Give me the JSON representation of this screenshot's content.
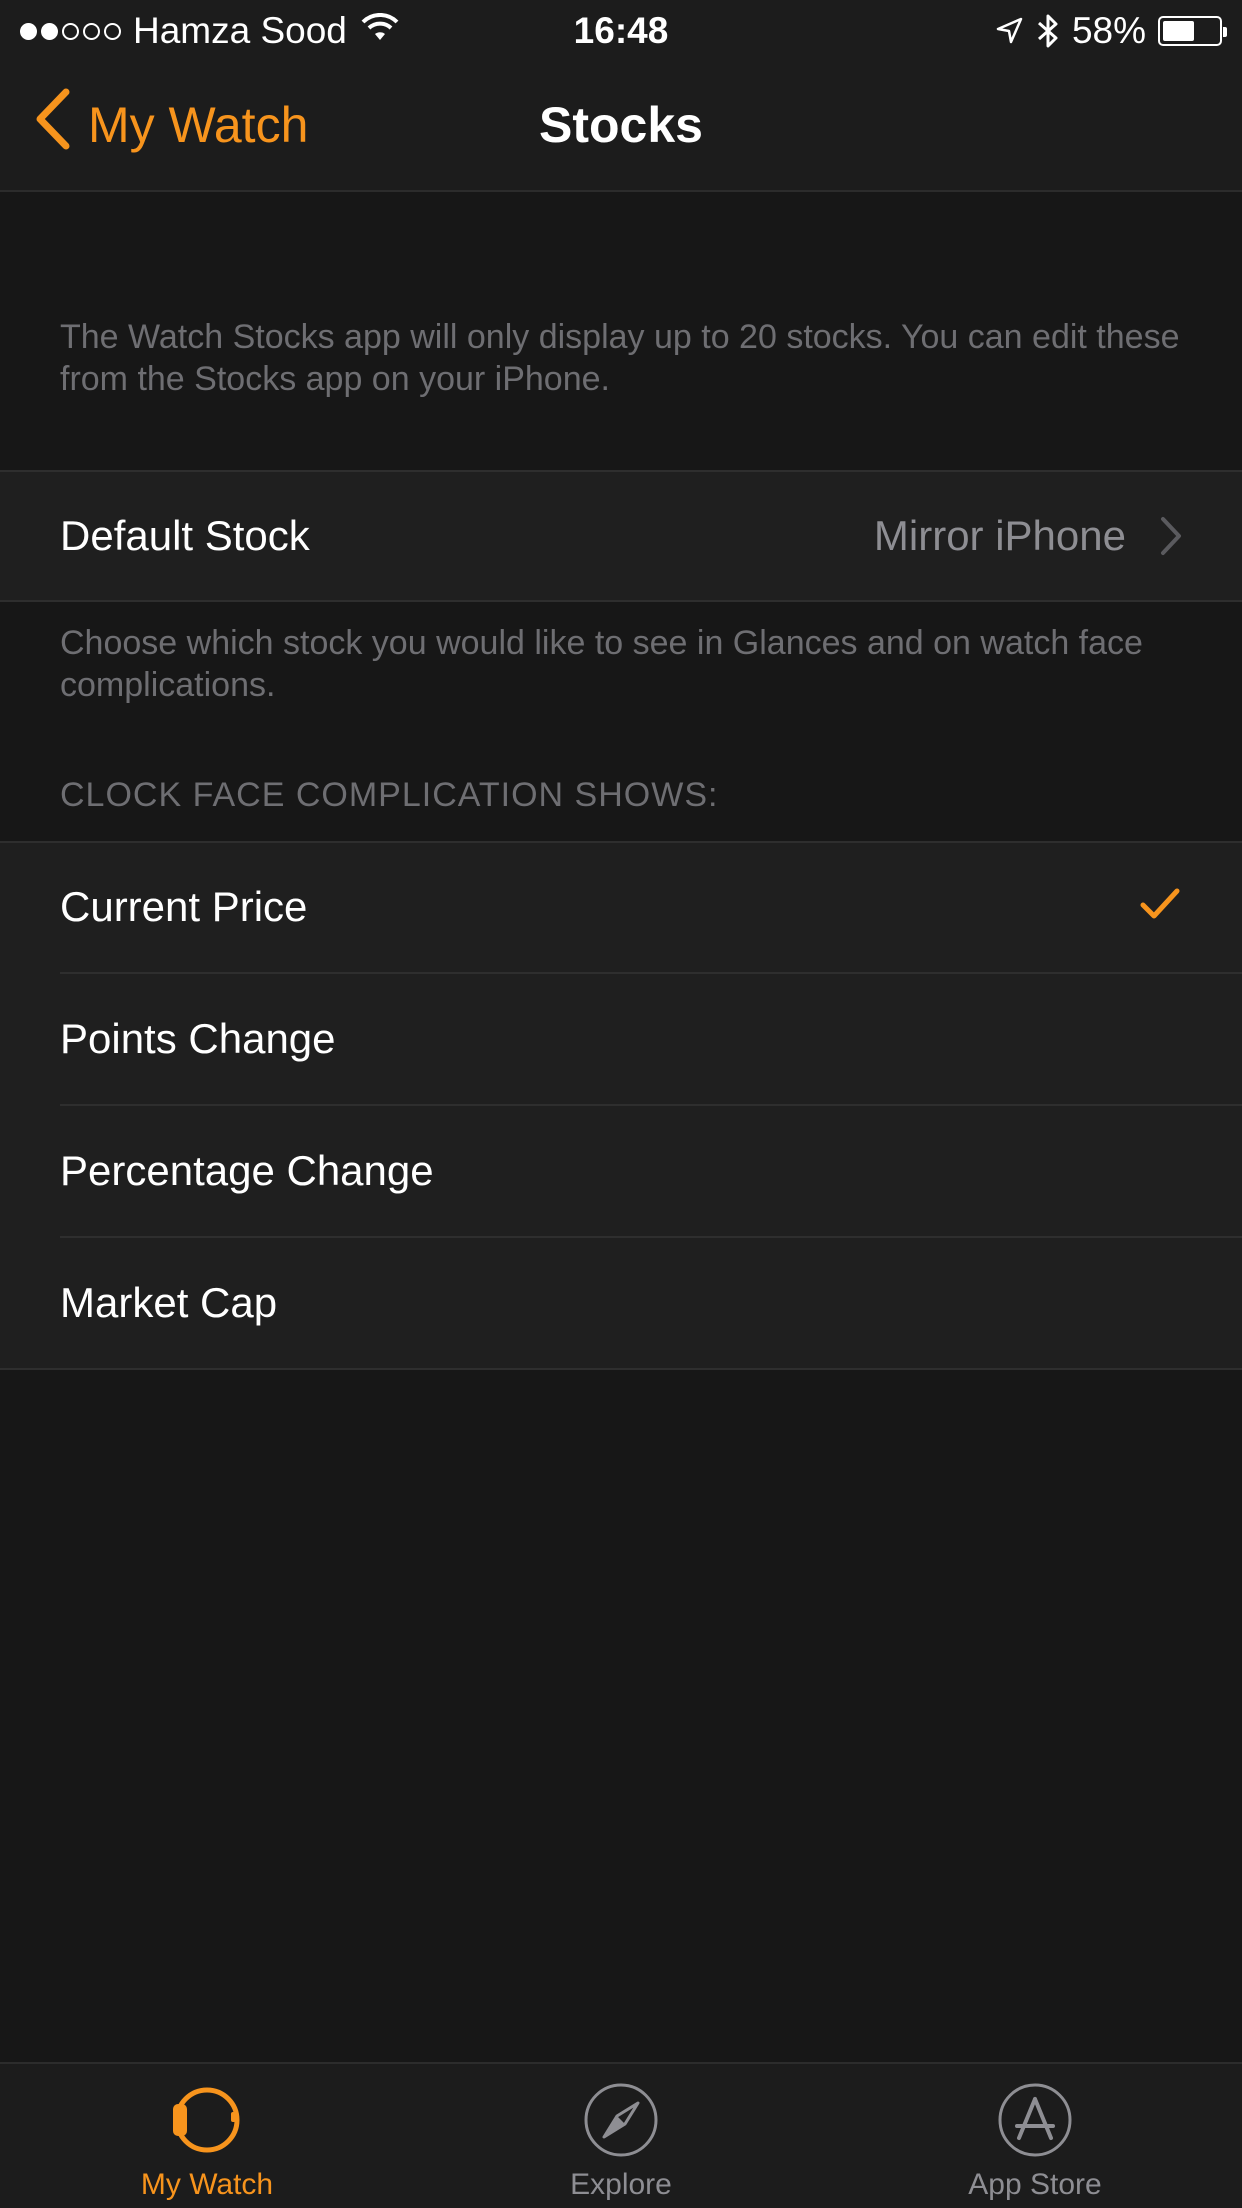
{
  "status_bar": {
    "carrier": "Hamza Sood",
    "time": "16:48",
    "battery": "58%",
    "battery_level": 0.58,
    "signal_bars": 2,
    "signal_total": 5
  },
  "nav": {
    "back_label": "My Watch",
    "title": "Stocks"
  },
  "intro_note": "The Watch Stocks app will only display up to 20 stocks. You can edit these from the Stocks app on your iPhone.",
  "default_stock": {
    "label": "Default Stock",
    "value": "Mirror iPhone",
    "footer": "Choose which stock you would like to see in Glances and on watch face complications."
  },
  "complication": {
    "header": "CLOCK FACE COMPLICATION SHOWS:",
    "options": [
      {
        "label": "Current Price",
        "selected": true
      },
      {
        "label": "Points Change",
        "selected": false
      },
      {
        "label": "Percentage Change",
        "selected": false
      },
      {
        "label": "Market Cap",
        "selected": false
      }
    ]
  },
  "tab_bar": {
    "tabs": [
      {
        "label": "My Watch",
        "icon": "watch-icon",
        "active": true
      },
      {
        "label": "Explore",
        "icon": "compass-icon",
        "active": false
      },
      {
        "label": "App Store",
        "icon": "app-store-icon",
        "active": false
      }
    ]
  },
  "colors": {
    "accent": "#f7941d",
    "background": "#171717",
    "cell": "#1f1f1f",
    "secondary_text": "#6e6e72"
  }
}
